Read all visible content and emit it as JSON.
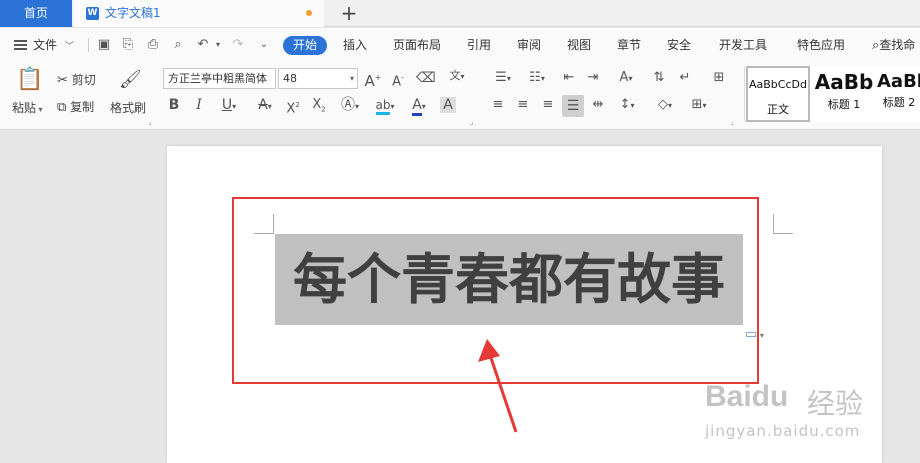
{
  "tabs": {
    "home_label": "首页",
    "doc_title": "文字文稿1",
    "doc_icon": "W"
  },
  "menu": {
    "file_label": "文件",
    "items": [
      "开始",
      "插入",
      "页面布局",
      "引用",
      "审阅",
      "视图",
      "章节",
      "安全",
      "开发工具",
      "特色应用"
    ],
    "search_label": "查找命"
  },
  "ribbon": {
    "paste_label": "粘贴",
    "cut_label": "剪切",
    "copy_label": "复制",
    "format_painter_label": "格式刷",
    "font_name": "方正兰亭中粗黑简体",
    "font_size": "48",
    "styles": [
      {
        "sample": "AaBbCcDd",
        "label": "正文"
      },
      {
        "sample": "AaBb",
        "label": "标题 1"
      },
      {
        "sample": "AaBb",
        "label": "标题 2"
      }
    ]
  },
  "document": {
    "selected_text": "每个青春都有故事"
  },
  "watermark": {
    "brand": "Baidu",
    "brand_cn": "经验",
    "url": "jingyan.baidu.com"
  },
  "colors": {
    "accent": "#2b73d6",
    "annotation_red": "#e53935",
    "selection": "#c0c0c0"
  }
}
